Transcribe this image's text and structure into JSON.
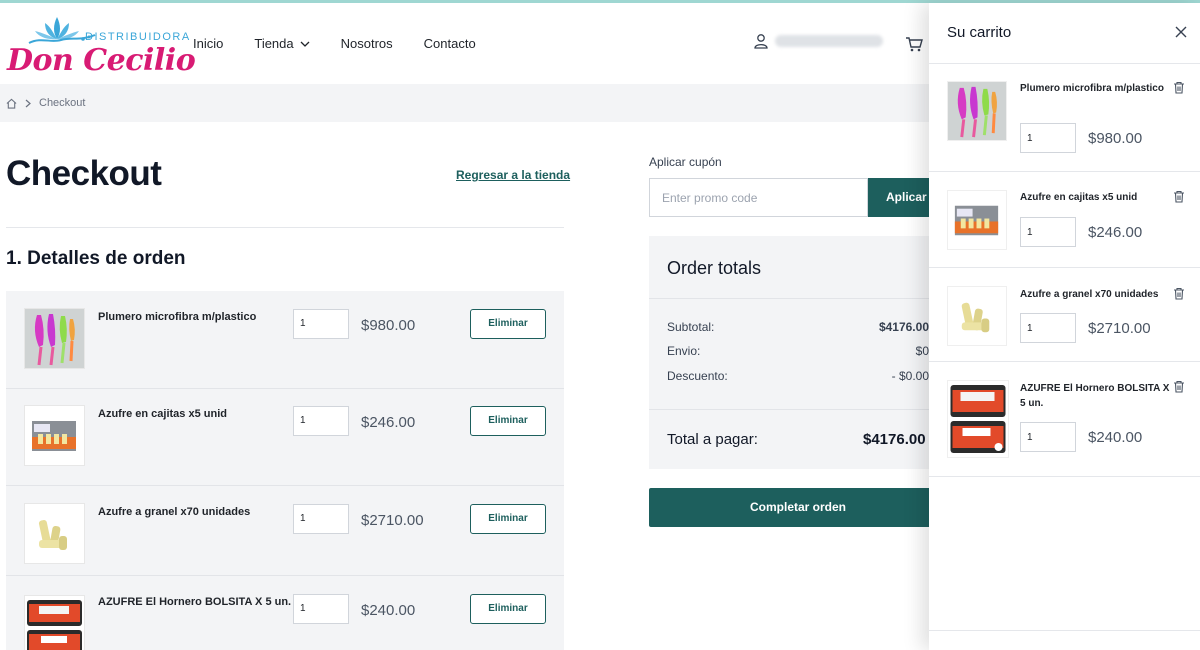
{
  "brand": {
    "top": "DISTRIBUIDORA",
    "name": "Don Cecilio"
  },
  "nav": {
    "items": [
      "Inicio",
      "Tienda",
      "Nosotros",
      "Contacto"
    ]
  },
  "breadcrumb": {
    "current": "Checkout"
  },
  "checkout": {
    "title": "Checkout",
    "back_link": "Regresar a la tienda",
    "section_title": "1. Detalles de orden",
    "remove_label": "Eliminar",
    "items": [
      {
        "name": "Plumero microfibra m/plastico",
        "qty": "1",
        "price": "$980.00"
      },
      {
        "name": "Azufre en cajitas x5 unid",
        "qty": "1",
        "price": "$246.00"
      },
      {
        "name": "Azufre a granel x70 unidades",
        "qty": "1",
        "price": "$2710.00"
      },
      {
        "name": "AZUFRE El Hornero BOLSITA X 5 un.",
        "qty": "1",
        "price": "$240.00"
      }
    ]
  },
  "coupon": {
    "label": "Aplicar cupón",
    "placeholder": "Enter promo code",
    "button": "Aplicar"
  },
  "totals": {
    "title": "Order totals",
    "subtotal_label": "Subtotal:",
    "subtotal": "$4176.00",
    "shipping_label": "Envio:",
    "shipping": "$0",
    "discount_label": "Descuento:",
    "discount": "- $0.00",
    "total_label": "Total a pagar:",
    "total": "$4176.00",
    "complete_button": "Completar orden"
  },
  "cart": {
    "title": "Su carrito",
    "items": [
      {
        "name": "Plumero microfibra m/plastico",
        "qty": "1",
        "price": "$980.00"
      },
      {
        "name": "Azufre en cajitas x5 unid",
        "qty": "1",
        "price": "$246.00"
      },
      {
        "name": "Azufre a granel x70 unidades",
        "qty": "1",
        "price": "$2710.00"
      },
      {
        "name": "AZUFRE El Hornero BOLSITA X 5 un.",
        "qty": "1",
        "price": "$240.00"
      }
    ]
  },
  "colors": {
    "brand_pink": "#d81b74",
    "brand_blue": "#3aa6d8",
    "accent_teal": "#1d5f5d"
  }
}
